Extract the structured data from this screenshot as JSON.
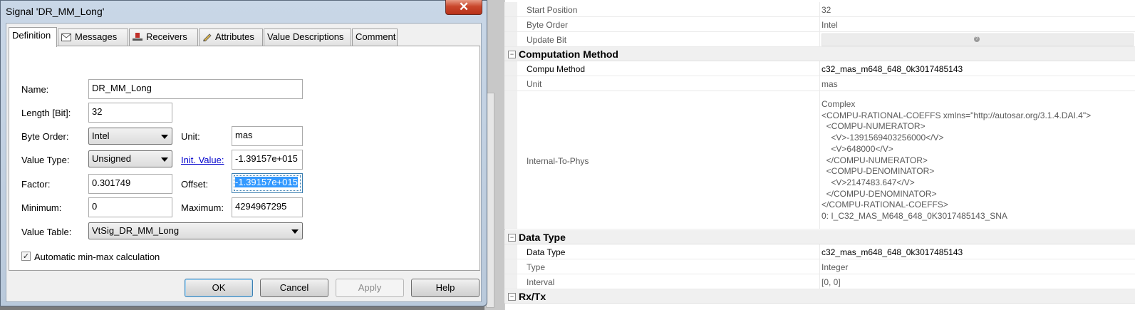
{
  "dialog": {
    "title": "Signal 'DR_MM_Long'",
    "close_glyph": "✕",
    "tabs": [
      {
        "label": "Definition",
        "icon": null
      },
      {
        "label": "Messages",
        "icon": "envelope-icon"
      },
      {
        "label": "Receivers",
        "icon": "receiver-icon"
      },
      {
        "label": "Attributes",
        "icon": "pencil-icon"
      },
      {
        "label": "Value Descriptions",
        "icon": null
      },
      {
        "label": "Comment",
        "icon": null
      }
    ],
    "form": {
      "name_label": "Name:",
      "name_value": "DR_MM_Long",
      "length_label": "Length [Bit]:",
      "length_value": "32",
      "byte_order_label": "Byte Order:",
      "byte_order_value": "Intel",
      "unit_label": "Unit:",
      "unit_value": "mas",
      "value_type_label": "Value Type:",
      "value_type_value": "Unsigned",
      "init_value_label": "Init. Value:",
      "init_value_value": "-1.39157e+015",
      "factor_label": "Factor:",
      "factor_value": "0.301749",
      "offset_label": "Offset:",
      "offset_value": "-1.39157e+015",
      "minimum_label": "Minimum:",
      "minimum_value": "0",
      "maximum_label": "Maximum:",
      "maximum_value": "4294967295",
      "value_table_label": "Value Table:",
      "value_table_value": "VtSig_DR_MM_Long",
      "auto_minmax_label": "Automatic min-max calculation",
      "auto_minmax_checked": true
    },
    "buttons": {
      "ok": "OK",
      "cancel": "Cancel",
      "apply": "Apply",
      "help": "Help"
    }
  },
  "grid": {
    "rows_top": [
      {
        "key": "Start Position",
        "value": "32"
      },
      {
        "key": "Byte Order",
        "value": "Intel"
      },
      {
        "key": "Update Bit",
        "value": ""
      }
    ],
    "computation": {
      "title": "Computation Method",
      "compu_method_key": "Compu Method",
      "compu_method_value": "c32_mas_m648_648_0k3017485143",
      "unit_key": "Unit",
      "unit_value": "mas",
      "internal_key": "Internal-To-Phys",
      "internal_value": "Complex\n<COMPU-RATIONAL-COEFFS xmlns=\"http://autosar.org/3.1.4.DAI.4\">\n  <COMPU-NUMERATOR>\n    <V>-1391569403256000</V>\n    <V>648000</V>\n  </COMPU-NUMERATOR>\n  <COMPU-DENOMINATOR>\n    <V>2147483.647</V>\n  </COMPU-DENOMINATOR>\n</COMPU-RATIONAL-COEFFS>\n0: I_C32_MAS_M648_648_0K3017485143_SNA"
    },
    "data_type": {
      "title": "Data Type",
      "data_type_key": "Data Type",
      "data_type_value": "c32_mas_m648_648_0k3017485143",
      "type_key": "Type",
      "type_value": "Integer",
      "interval_key": "Interval",
      "interval_value": "[0, 0]"
    },
    "rxtx": {
      "title": "Rx/Tx"
    }
  }
}
